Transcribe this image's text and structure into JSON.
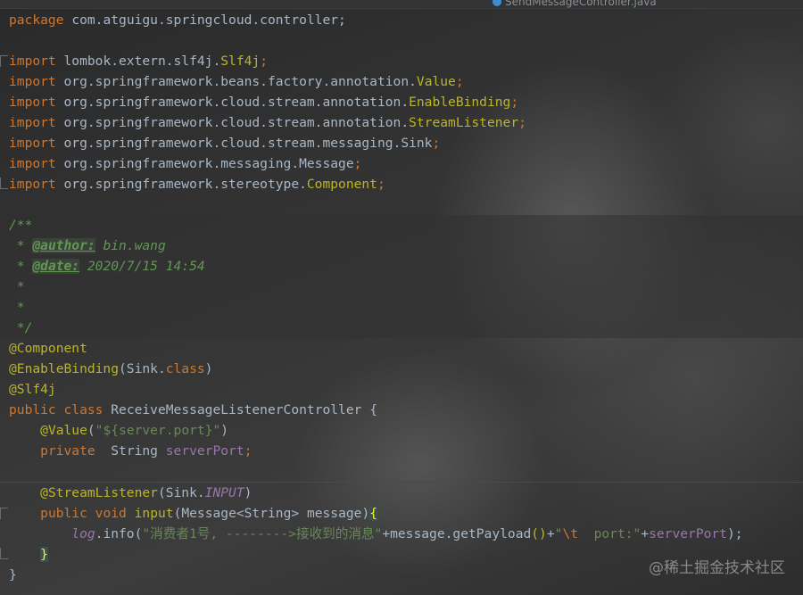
{
  "tab": {
    "filename": "SendMessageController.java"
  },
  "code": {
    "package_kw": "package",
    "package_name": "com.atguigu.springcloud.controller;",
    "imports": [
      {
        "kw": "import",
        "path": "lombok.extern.slf4j.",
        "cls": "Slf4j",
        "end": ";"
      },
      {
        "kw": "import",
        "path": "org.springframework.beans.factory.annotation.",
        "cls": "Value",
        "end": ";"
      },
      {
        "kw": "import",
        "path": "org.springframework.cloud.stream.annotation.",
        "cls": "EnableBinding",
        "end": ";"
      },
      {
        "kw": "import",
        "path": "org.springframework.cloud.stream.annotation.",
        "cls": "StreamListener",
        "end": ";"
      },
      {
        "kw": "import",
        "path": "org.springframework.cloud.stream.messaging.Sink",
        "cls": "",
        "end": ";"
      },
      {
        "kw": "import",
        "path": "org.springframework.messaging.Message",
        "cls": "",
        "end": ";"
      },
      {
        "kw": "import",
        "path": "org.springframework.stereotype.",
        "cls": "Component",
        "end": ";"
      }
    ],
    "doc": {
      "open": "/**",
      "author_tag": "@author:",
      "author_value": " bin.wang",
      "date_tag": "@date:",
      "date_value": " 2020/7/15 14:54",
      "star": " *",
      "close": " */"
    },
    "ann_component": "@Component",
    "ann_enable_binding": "@EnableBinding",
    "enable_binding_arg_open": "(Sink.",
    "class_kw": "class",
    "paren_close": ")",
    "ann_slf4j": "@Slf4j",
    "public_kw": "public",
    "class_name": "ReceiveMessageListenerController",
    "brace_open": "{",
    "brace_close": "}",
    "ann_value": "@Value",
    "value_arg": "\"${server.port}\"",
    "private_kw": "private",
    "type_string": "String",
    "field_name": "serverPort",
    "semicolon": ";",
    "ann_stream_listener": "@StreamListener",
    "sink_prefix": "(Sink.",
    "input_const": "INPUT",
    "void_kw": "void",
    "method_name": "input",
    "param_type": "Message<String>",
    "param_name": "message",
    "log_var": "log",
    "info_call": ".info(",
    "log_str": "\"消费者1号, -------->接收到的消息\"",
    "concat1": "+message.getPayload",
    "parens": "()",
    "concat2": "+",
    "tab_str_q": "\"",
    "tab_escape": "\\t",
    "port_str": "  port:\"",
    "concat3": "+",
    "end_call": ");"
  },
  "watermark": "@稀土掘金技术社区"
}
